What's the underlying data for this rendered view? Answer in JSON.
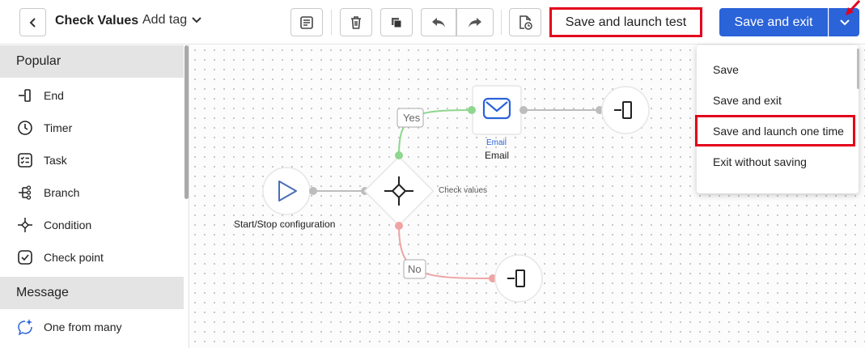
{
  "toolbar": {
    "title": "Check Values",
    "add_tag_label": "Add tag",
    "save_and_launch_test_label": "Save and launch test",
    "save_and_exit_label": "Save and exit"
  },
  "sidebar": {
    "sections": [
      {
        "title": "Popular"
      },
      {
        "title": "Message"
      }
    ],
    "popular_items": [
      {
        "label": "End",
        "icon": "end-icon"
      },
      {
        "label": "Timer",
        "icon": "timer-icon"
      },
      {
        "label": "Task",
        "icon": "task-icon"
      },
      {
        "label": "Branch",
        "icon": "branch-icon"
      },
      {
        "label": "Condition",
        "icon": "condition-icon"
      },
      {
        "label": "Check point",
        "icon": "check-point-icon"
      }
    ],
    "message_items": [
      {
        "label": "One from many",
        "icon": "sparkle-chat-icon"
      }
    ]
  },
  "canvas": {
    "start_label": "Start/Stop configuration",
    "condition_label": "Check values",
    "yes_label": "Yes",
    "no_label": "No",
    "email_icon_caption": "Email",
    "email_label": "Email"
  },
  "dropdown": {
    "items": [
      "Save",
      "Save and exit",
      "Save and launch one time",
      "Exit without saving"
    ]
  },
  "colors": {
    "primary": "#2b63d9",
    "highlight": "#e3001b",
    "yes_edge": "#8fd68f",
    "no_edge": "#f0a3a3"
  }
}
